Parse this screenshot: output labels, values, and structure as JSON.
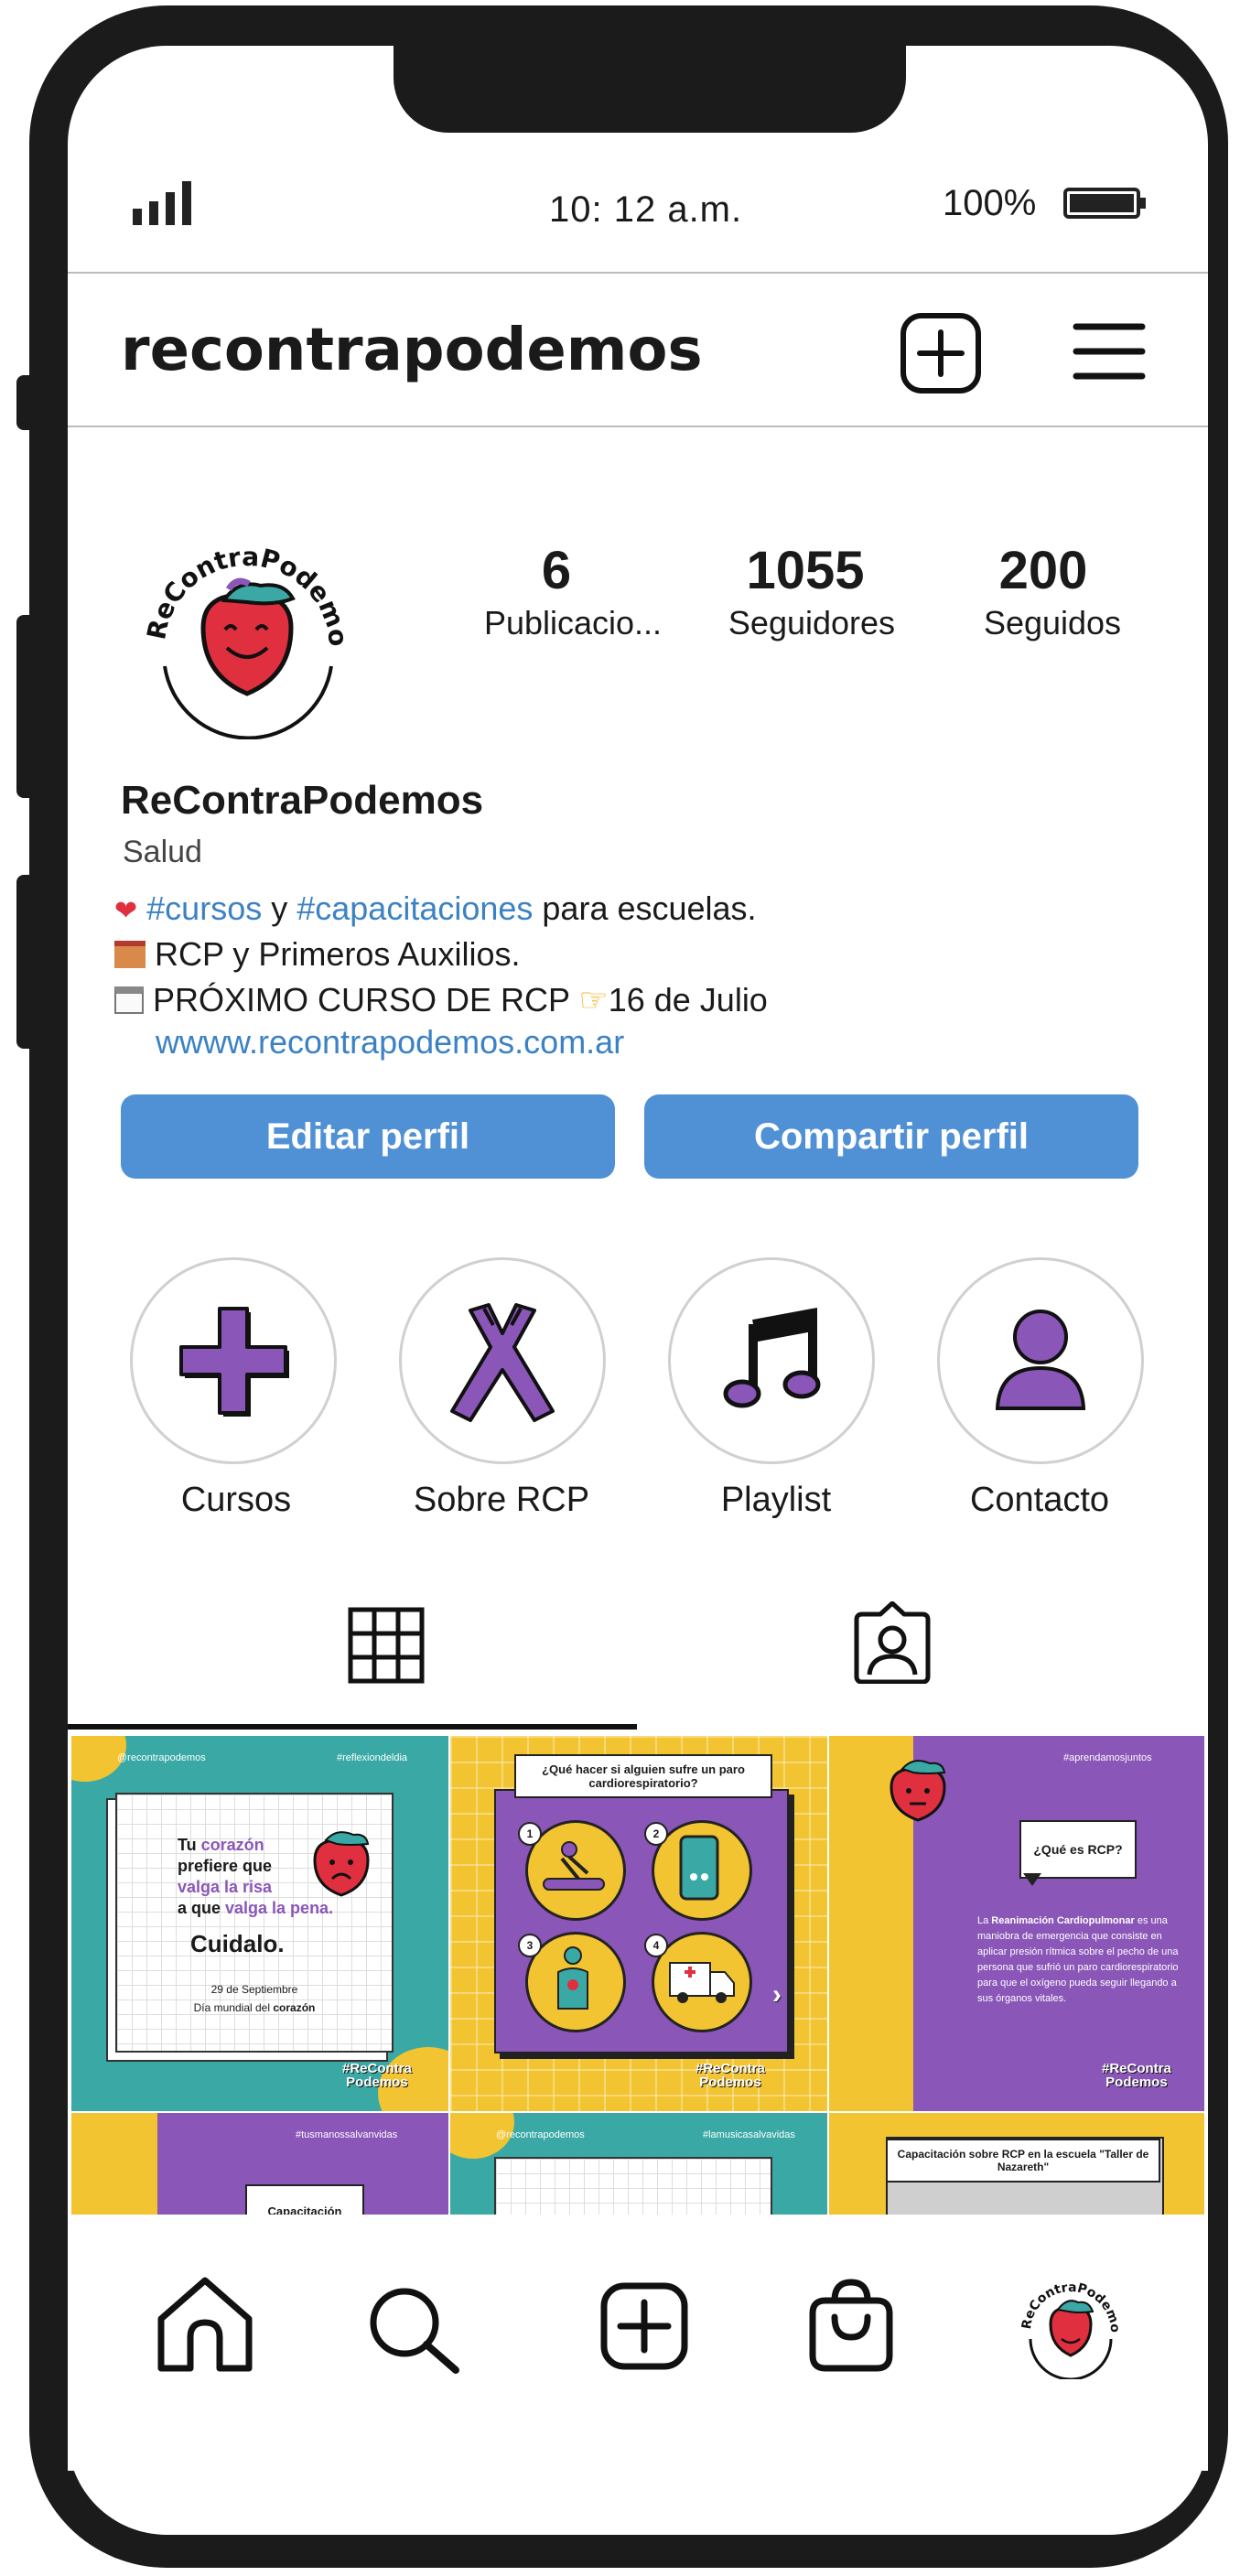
{
  "status_bar": {
    "time": "10: 12 a.m.",
    "battery": "100%"
  },
  "header": {
    "username": "recontrapodemos"
  },
  "profile": {
    "avatar_text": "#ReContraPodemos",
    "stats": [
      {
        "value": "6",
        "label": "Publicacio..."
      },
      {
        "value": "1055",
        "label": "Seguidores"
      },
      {
        "value": "200",
        "label": "Seguidos"
      }
    ],
    "display_name": "ReContraPodemos",
    "category": "Salud",
    "bio": {
      "line1_tag1": "#cursos",
      "line1_mid": " y ",
      "line1_tag2": "#capacitaciones",
      "line1_end": " para escuelas.",
      "line2": "RCP y Primeros Auxilios.",
      "line3_start": "PRÓXIMO CURSO DE RCP ",
      "line3_end": "16 de Julio",
      "link": "wwww.recontrapodemos.com.ar"
    }
  },
  "buttons": {
    "edit": "Editar perfil",
    "share": "Compartir perfil"
  },
  "highlights": [
    {
      "label": "Cursos",
      "icon": "plus-icon"
    },
    {
      "label": "Sobre RCP",
      "icon": "hands-icon"
    },
    {
      "label": "Playlist",
      "icon": "music-note-icon"
    },
    {
      "label": "Contacto",
      "icon": "person-icon"
    }
  ],
  "posts": {
    "p1": {
      "handle": "@recontrapodemos",
      "tag": "#reflexiondeldia",
      "text_a": "Tu ",
      "text_b": "corazón",
      "text_c": "prefiere que",
      "text_d": "valga la risa",
      "text_e": "a que ",
      "text_f": "valga la pena.",
      "cta": "Cuidalo.",
      "date": "29 de Septiembre",
      "day_a": "Día mundial del ",
      "day_b": "corazón",
      "logo_a": "#ReContra",
      "logo_b": "Podemos"
    },
    "p2": {
      "title": "¿Qué hacer si alguien sufre un paro cardiorespiratorio?",
      "steps": [
        "1",
        "2",
        "3",
        "4"
      ],
      "logo_a": "#ReContra",
      "logo_b": "Podemos"
    },
    "p3": {
      "tag": "#aprendamosjuntos",
      "bubble": "¿Qué es RCP?",
      "body_a": "La ",
      "body_b": "Reanimación Cardiopulmonar",
      "body_c": "es una maniobra de emergencia que consiste en aplicar presión rítmica sobre el pecho de una persona que sufrió un paro cardiorespiratorio para que el oxígeno pueda seguir llegando a sus órganos vitales.",
      "logo_a": "#ReContra",
      "logo_b": "Podemos"
    },
    "p4": {
      "tag": "#tusmanossalvanvidas",
      "label": "Capacitación"
    },
    "p5": {
      "handle": "@recontrapodemos",
      "tag": "#lamusicasalvavidas"
    },
    "p6": {
      "title": "Capacitación sobre RCP en la escuela \"Taller de Nazareth\""
    }
  },
  "colors": {
    "purple": "#8a56b8",
    "teal": "#3aa9a5",
    "yellow": "#f3c431",
    "red": "#e0303f",
    "accent_blue": "#5091d6"
  }
}
